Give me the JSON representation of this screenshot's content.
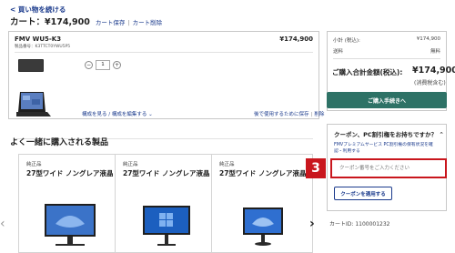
{
  "header": {
    "back_label": "< 買い物を続ける",
    "cart_title": "カート：¥174,900",
    "save_label": "カート保存",
    "clear_label": "カート削除"
  },
  "product": {
    "name": "FMV WU5-K3",
    "code": "製品番号：K3TTCT0YWU5P5",
    "price": "¥174,900",
    "quantity": "1",
    "minus_icon": "−",
    "plus_icon": "+",
    "config_label": "構成を見る / 構成を編集する ⌄",
    "save_later_label": "後で使用するために保存",
    "delete_label": "削除"
  },
  "summary": {
    "subtotal_label": "小計 (税込):",
    "subtotal_value": "¥174,900",
    "shipping_label": "送料",
    "shipping_value": "無料",
    "total_label": "ご購入合計金額(税込):",
    "total_value": "¥174,900",
    "tax_note": "(消費税含む)",
    "checkout_label": "ご購入手続きへ"
  },
  "coupon": {
    "heading": "クーポン、PC割引権をお持ちですか？ ⌃",
    "fmv_link": "FMVプレミアムサービス PC割引権の保有状況を確認・利用する",
    "input_placeholder": "クーポン番号をご入力ください",
    "apply_label": "クーポンを適用する",
    "step_number": "3"
  },
  "cart_id": "カートID: 1100001232",
  "recommended": {
    "heading": "よく一緒に購入される製品",
    "items": [
      {
        "badge": "純正品",
        "name": "27型ワイド ノングレア液晶"
      },
      {
        "badge": "純正品",
        "name": "27型ワイド ノングレア液晶"
      },
      {
        "badge": "純正品",
        "name": "27型ワイド ノングレア液晶"
      }
    ],
    "prev_icon": "‹",
    "next_icon": "›"
  },
  "colors": {
    "link": "#1a3a8c",
    "checkout": "#2e7266",
    "highlight": "#c9161d"
  }
}
